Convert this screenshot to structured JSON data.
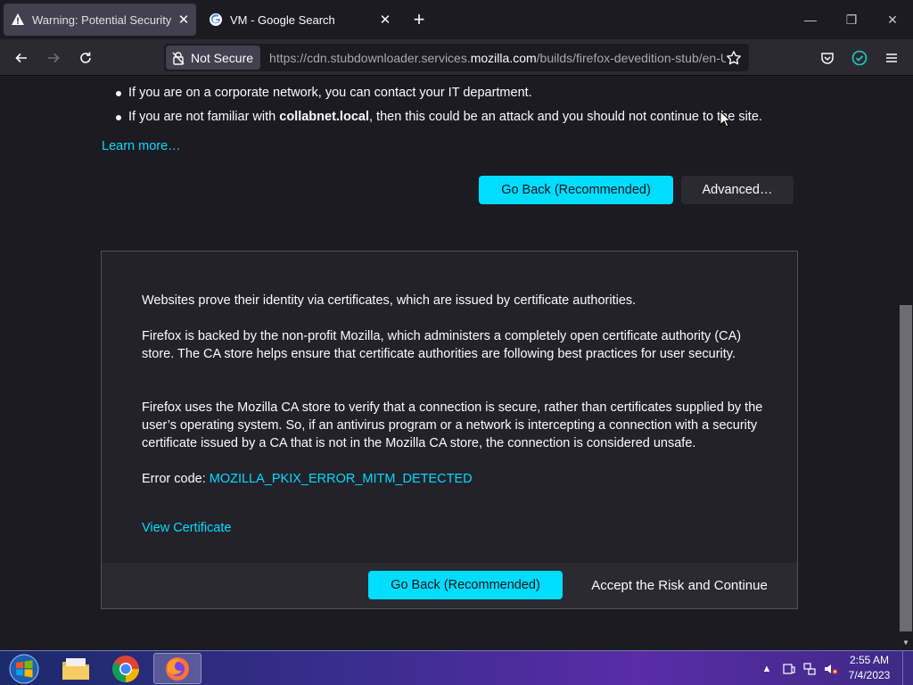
{
  "tabs": [
    {
      "title": "Warning: Potential Security Risk Ahead",
      "icon": "warning-icon",
      "active": true
    },
    {
      "title": "VM - Google Search",
      "icon": "google-icon",
      "active": false
    }
  ],
  "toolbar": {
    "security_label": "Not Secure",
    "url_prefix": "https://cdn.stubdownloader.services.",
    "url_host": "mozilla.com",
    "url_path": "/builds/firefox-devedition-stub/en-US/"
  },
  "warning": {
    "bullets": [
      {
        "text": "If you are on a corporate network, you can contact your IT department."
      },
      {
        "prefix": "If you are not familiar with ",
        "host": "collabnet.local",
        "suffix": ", then this could be an attack and you should not continue to the site."
      }
    ],
    "learn_more": "Learn more…",
    "go_back_label": "Go Back (Recommended)",
    "advanced_label": "Advanced…"
  },
  "advanced_panel": {
    "para1": "Websites prove their identity via certificates, which are issued by certificate authorities.",
    "para2": "Firefox is backed by the non-profit Mozilla, which administers a completely open certificate authority (CA) store. The CA store helps ensure that certificate authorities are following best practices for user security.",
    "para3": "Firefox uses the Mozilla CA store to verify that a connection is secure, rather than certificates supplied by the user’s operating system. So, if an antivirus program or a network is intercepting a connection with a security certificate issued by a CA that is not in the Mozilla CA store, the connection is considered unsafe.",
    "error_code_label": "Error code: ",
    "error_code": "MOZILLA_PKIX_ERROR_MITM_DETECTED",
    "view_certificate": "View Certificate",
    "go_back_label": "Go Back (Recommended)",
    "accept_label": "Accept the Risk and Continue"
  },
  "taskbar": {
    "apps": [
      "file-explorer-icon",
      "chrome-icon",
      "firefox-icon"
    ],
    "time": "2:55 AM",
    "date": "7/4/2023"
  },
  "colors": {
    "accent": "#00ddff",
    "page_bg": "#1c1b22",
    "panel_bg": "#23222b"
  }
}
